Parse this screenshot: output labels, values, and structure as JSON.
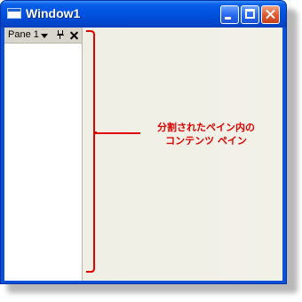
{
  "window": {
    "title": "Window1"
  },
  "pane": {
    "title": "Pane 1"
  },
  "annotation": {
    "line1": "分割されたペイン内の",
    "line2": "コンテンツ ペイン",
    "color": "#e00000"
  }
}
